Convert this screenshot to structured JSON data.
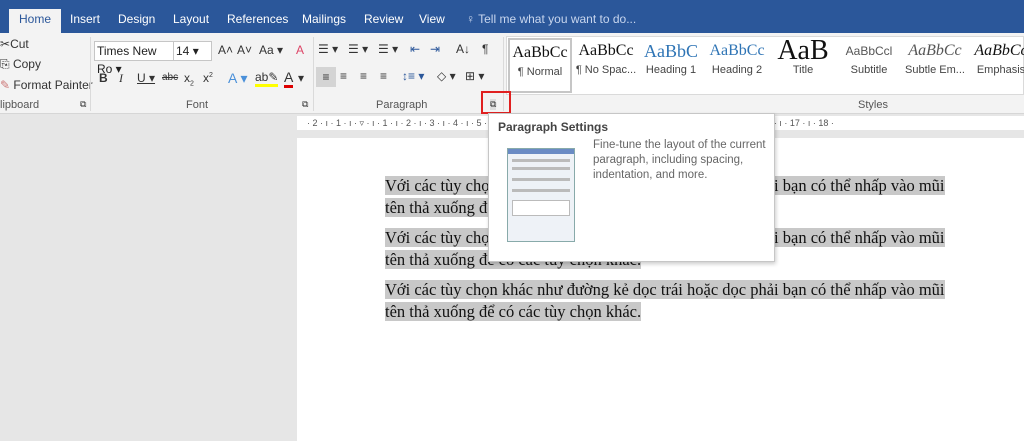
{
  "tabs": [
    "Home",
    "Insert",
    "Design",
    "Layout",
    "References",
    "Mailings",
    "Review",
    "View"
  ],
  "tell_me": "Tell me what you want to do...",
  "clipboard": {
    "cut": "Cut",
    "copy": "Copy",
    "format_painter": "Format Painter",
    "label": "lipboard"
  },
  "font": {
    "name": "Times New Ro",
    "size": "14",
    "label": "Font",
    "change_case": "Aa"
  },
  "paragraph": {
    "label": "Paragraph"
  },
  "styles": {
    "label": "Styles",
    "items": [
      {
        "sample": "AaBbCc",
        "name": "¶ Normal"
      },
      {
        "sample": "AaBbCc",
        "name": "¶ No Spac..."
      },
      {
        "sample": "AaBbC",
        "name": "Heading 1"
      },
      {
        "sample": "AaBbCc",
        "name": "Heading 2"
      },
      {
        "sample": "AaB",
        "name": "Title"
      },
      {
        "sample": "AaBbCcl",
        "name": "Subtitle"
      },
      {
        "sample": "AaBbCc",
        "name": "Subtle Em..."
      },
      {
        "sample": "AaBbCc",
        "name": "Emphasis"
      }
    ]
  },
  "ruler": "· 2 · ı · 1 · ı · ▿ · ı · 1 · ı · 2 · ı · 3 · ı · 4 · ı · 5 · ı · 6 · ı · 7 · ı · 8 · ı · 9 · ı · 10 · ı · 11 · ı · 12 · ı · 13 · ı · 14 · ı · 15 · ı · △ · ı · 17 · ı · 18 ·",
  "tooltip": {
    "title": "Paragraph Settings",
    "body": "Fine-tune the layout of the current paragraph, including spacing, indentation, and more."
  },
  "document": {
    "paragraphs": [
      "Với các tùy chọn khác như đường kẻ dọc trái hoặc dọc phải bạn có thể nhấp vào mũi tên thả xuống để có các tùy chọn khác.",
      "Với các tùy chọn khác như đường kẻ dọc trái hoặc dọc phải bạn có thể nhấp vào mũi tên thả xuống để có các tùy chọn khác.",
      "Với các tùy chọn khác như đường kẻ dọc trái hoặc dọc phải bạn có thể nhấp vào mũi tên thả xuống để có các tùy chọn khác."
    ]
  }
}
